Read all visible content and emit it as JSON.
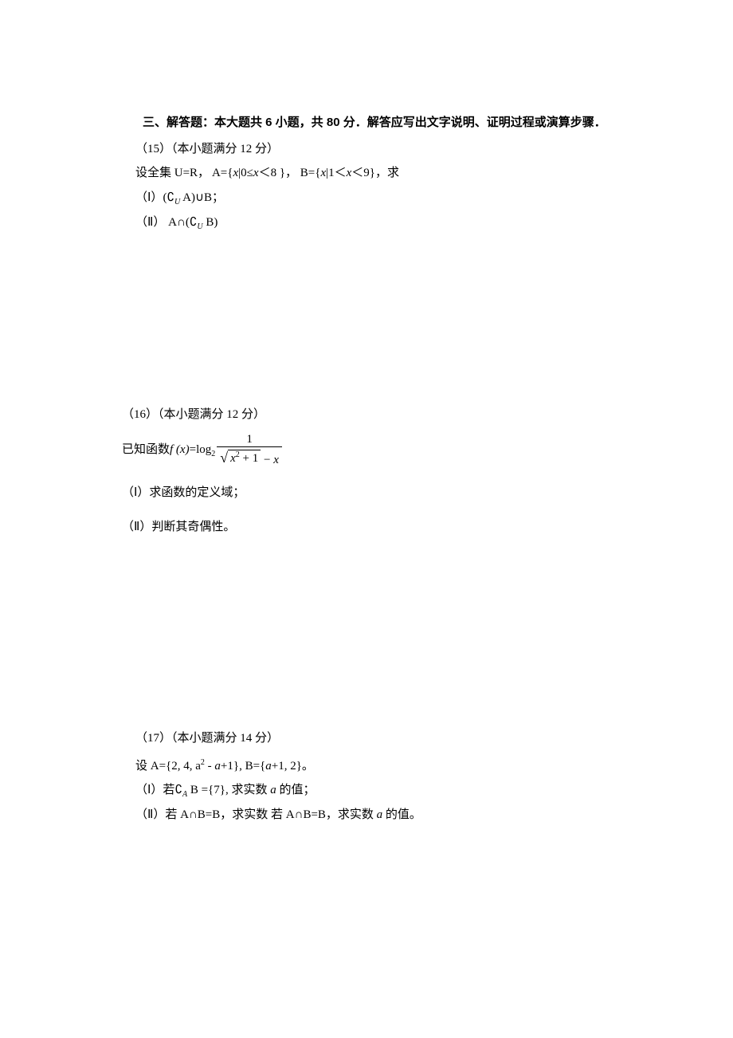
{
  "section": {
    "heading_prefix": "三、解答题：本大题共 ",
    "count": "6",
    "heading_mid": " 小题，共 ",
    "points": "80",
    "heading_suffix": " 分．解答应写出文字说明、证明过程或演算步骤．"
  },
  "q15": {
    "header": "（15）（本小题满分 12 分）",
    "stem_pre": "设全集 U=R， A={",
    "var1": "x",
    "stem_mid1": "|0≤",
    "var2": "x",
    "stem_mid2": "＜8 }， B={",
    "var3": "x",
    "stem_mid3": "|1＜",
    "var4": "x",
    "stem_tail": "＜9}，求",
    "p1_roman": "（Ⅰ）",
    "p1_pre": "(",
    "p1_comp": "∁",
    "p1_sub": "U",
    "p1_set1": " A)",
    "p1_op": "∪",
    "p1_set2": "B；",
    "p2_roman": "（Ⅱ）",
    "p2_set1": " A",
    "p2_op": "∩",
    "p2_pre": "(",
    "p2_comp": "∁",
    "p2_sub": "U",
    "p2_set2": " B)"
  },
  "q16": {
    "header": "（16）（本小题满分 12 分）",
    "stem_pre": "已知函数 ",
    "fx": "f (x)",
    "eq": "=",
    "log": "log",
    "logbase": "2",
    "num": "1",
    "radicand_x": "x",
    "radicand_sup": "2",
    "radicand_plus": " + 1",
    "minus": " − ",
    "den_tail_x": "x",
    "p1": "（Ⅰ）求函数的定义域；",
    "p2": "（Ⅱ）判断其奇偶性。"
  },
  "q17": {
    "header": "（17）（本小题满分 14 分）",
    "stem_pre": "设 A={2, 4, a",
    "sup2": "2",
    "stem_mid1": " - ",
    "var_a1": "a",
    "stem_mid2": "+1}, B={",
    "var_a2": "a",
    "stem_tail": "+1, 2}。",
    "p1_roman": "（Ⅰ）若",
    "p1_comp": "∁",
    "p1_sub": "A",
    "p1_mid": " B ={7}, 求实数 ",
    "p1_var": "a",
    "p1_tail": " 的值；",
    "p2_roman": "（Ⅱ）若 A∩B=B，求实数 ",
    "p2_var": "a",
    "p2_tail": " 的值。"
  }
}
